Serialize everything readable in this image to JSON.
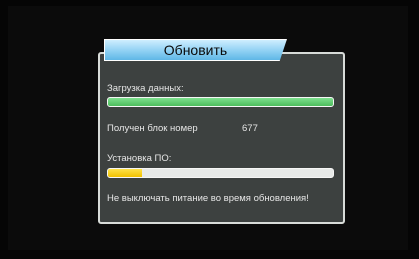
{
  "dialog": {
    "title": "Обновить",
    "download_label": "Загрузка данных:",
    "download_progress": 1.0,
    "block_label": "Получен блок номер",
    "block_number": "677",
    "install_label": "Установка ПО:",
    "install_progress": 0.15,
    "warning": "Не выключать питание во время обновления!"
  },
  "colors": {
    "dialog_bg": "#3d4140",
    "title_tab": "#8fd0f3",
    "download_bar": "#4cbc5c",
    "install_bar": "#f2c100"
  }
}
